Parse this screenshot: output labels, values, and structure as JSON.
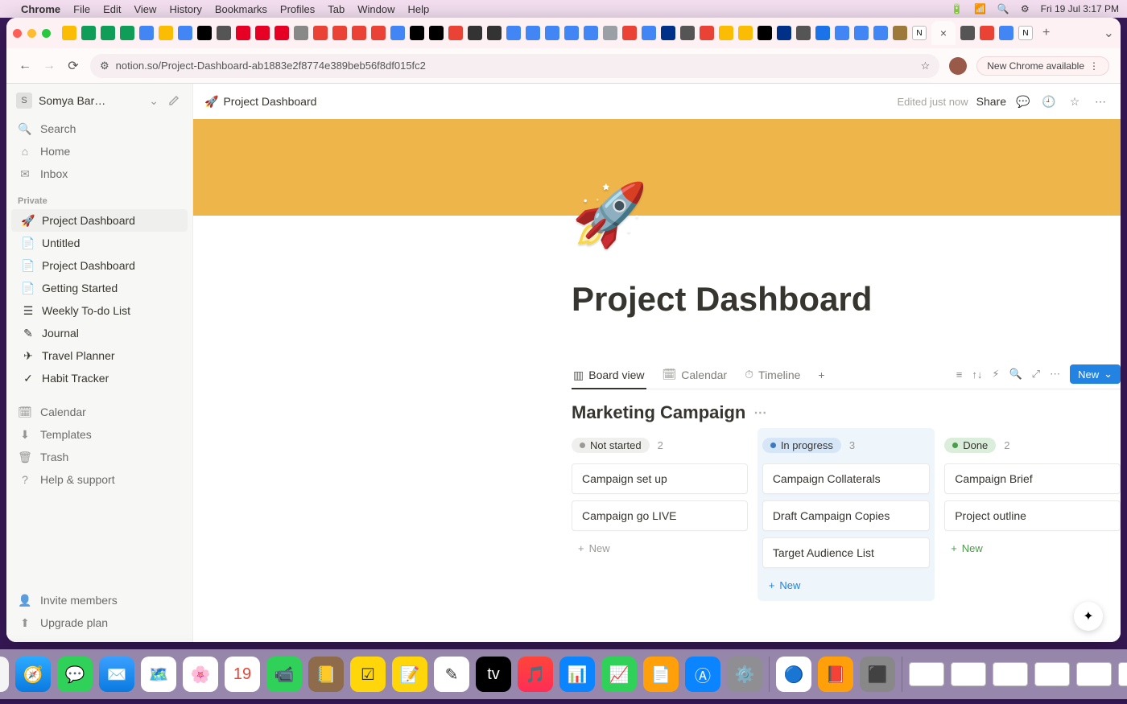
{
  "menubar": {
    "app": "Chrome",
    "items": [
      "File",
      "Edit",
      "View",
      "History",
      "Bookmarks",
      "Profiles",
      "Tab",
      "Window",
      "Help"
    ],
    "datetime": "Fri 19 Jul  3:17 PM"
  },
  "chrome": {
    "url": "notion.so/Project-Dashboard-ab1883e2f8774e389beb56f8df015fc2",
    "badge": "New Chrome available",
    "active_tab_close": "×",
    "newtab_plus": "+"
  },
  "sidebar": {
    "workspace": "Somya Bar…",
    "nav": [
      {
        "icon": "🔍",
        "label": "Search"
      },
      {
        "icon": "⌂",
        "label": "Home"
      },
      {
        "icon": "✉︎",
        "label": "Inbox"
      }
    ],
    "section": "Private",
    "pages": [
      {
        "icon": "🚀",
        "label": "Project Dashboard",
        "selected": true
      },
      {
        "icon": "📄",
        "label": "Untitled"
      },
      {
        "icon": "📄",
        "label": "Project Dashboard"
      },
      {
        "icon": "📄",
        "label": "Getting Started"
      },
      {
        "icon": "☰",
        "label": "Weekly To-do List"
      },
      {
        "icon": "✎",
        "label": "Journal"
      },
      {
        "icon": "✈︎",
        "label": "Travel Planner"
      },
      {
        "icon": "✓",
        "label": "Habit Tracker"
      }
    ],
    "utils": [
      {
        "icon": "🗓",
        "label": "Calendar"
      },
      {
        "icon": "⬇︎",
        "label": "Templates"
      },
      {
        "icon": "🗑",
        "label": "Trash"
      },
      {
        "icon": "?",
        "label": "Help & support"
      }
    ],
    "footer": [
      {
        "icon": "👤",
        "label": "Invite members"
      },
      {
        "icon": "⬆︎",
        "label": "Upgrade plan"
      }
    ]
  },
  "topbar": {
    "icon": "🚀",
    "breadcrumb": "Project Dashboard",
    "edited": "Edited just now",
    "share": "Share"
  },
  "page": {
    "icon": "🚀",
    "title": "Project Dashboard"
  },
  "database": {
    "views": [
      {
        "icon": "▥",
        "label": "Board view",
        "active": true
      },
      {
        "icon": "🗓",
        "label": "Calendar"
      },
      {
        "icon": "⏱",
        "label": "Timeline"
      }
    ],
    "new_label": "New",
    "title": "Marketing Campaign",
    "columns": [
      {
        "status": "Not started",
        "color": "gray",
        "count": 2,
        "cards": [
          "Campaign set up",
          "Campaign go LIVE"
        ],
        "newstyle": "gray"
      },
      {
        "status": "In progress",
        "color": "blue",
        "count": 3,
        "cards": [
          "Campaign Collaterals",
          "Draft Campaign Copies",
          "Target Audience List"
        ],
        "newstyle": "blue",
        "highlight": true
      },
      {
        "status": "Done",
        "color": "green",
        "count": 2,
        "cards": [
          "Campaign Brief",
          "Project outline"
        ],
        "newstyle": "green"
      }
    ],
    "add_label": "New"
  }
}
